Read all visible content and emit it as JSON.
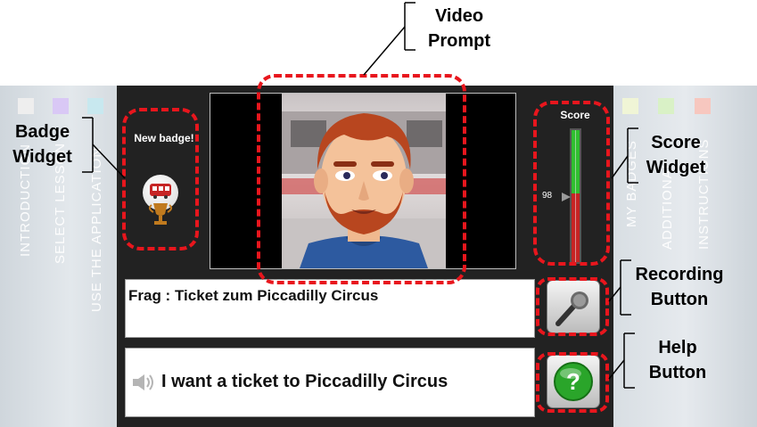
{
  "side_nav_left": [
    {
      "label": "INTRODUCTION",
      "color": "#eeeeee"
    },
    {
      "label": "SELECT LESSON",
      "color": "#d9c8f5"
    },
    {
      "label": "USE THE APPLICATION",
      "color": "#c8e8ef"
    }
  ],
  "side_nav_right": [
    {
      "label": "MY BADGES",
      "color": "#f0f5d6"
    },
    {
      "label": "ADDITIONAL",
      "color": "#d9f1c6"
    },
    {
      "label": "INSTRUCTIONS",
      "color": "#f7c7bf"
    }
  ],
  "badge": {
    "label": "New badge!",
    "icon": "bus-trophy-icon"
  },
  "score": {
    "title": "Score",
    "value": "98",
    "level": 0.52
  },
  "prompt": {
    "text": "Frag : Ticket zum Piccadilly Circus"
  },
  "answer": {
    "text": "I want a ticket to Piccadilly Circus",
    "icon": "speaker-icon"
  },
  "buttons": {
    "record_icon": "microphone-icon",
    "help_icon": "help-question-icon"
  },
  "annotations": {
    "video": [
      "Video",
      "Prompt"
    ],
    "badge": [
      "Badge",
      "Widget"
    ],
    "score": [
      "Score",
      "Widget"
    ],
    "recording": [
      "Recording",
      "Button"
    ],
    "help": [
      "Help",
      "Button"
    ]
  },
  "colors": {
    "highlight": "#e8161d",
    "panel": "#222222",
    "score_green": "#2fbf2f",
    "score_red": "#c62424",
    "help_green": "#2aa52a"
  }
}
